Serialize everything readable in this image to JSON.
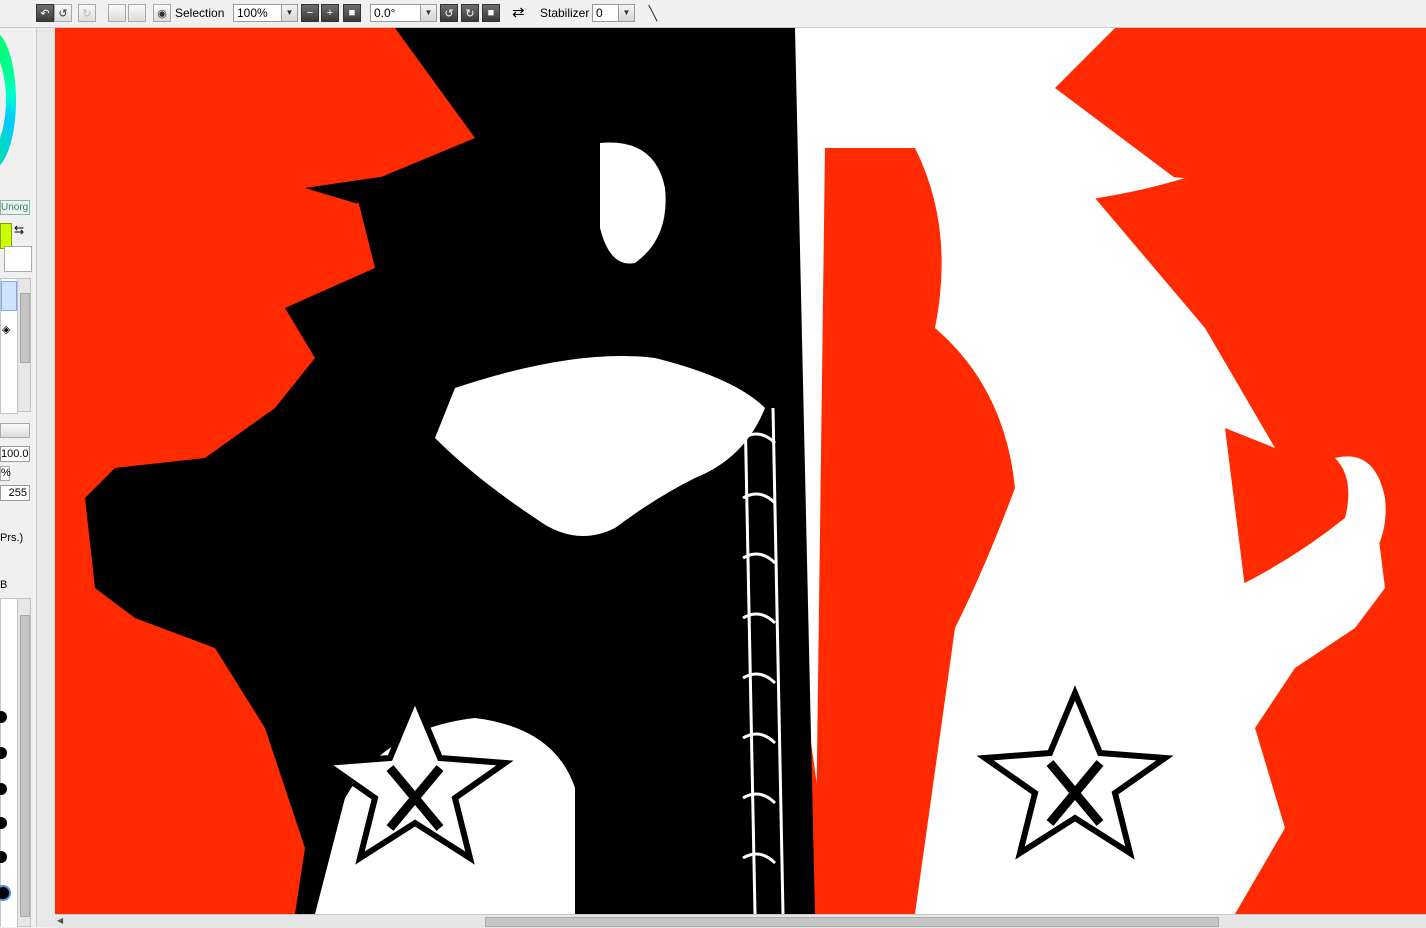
{
  "toolbar": {
    "selection_label": "Selection",
    "zoom_value": "100%",
    "rotation_value": "0.0°",
    "stabilizer_label": "Stabilizer",
    "stabilizer_value": "0"
  },
  "left_panel": {
    "mode_label": "Unorg",
    "opacity_value": "100.0",
    "percent_sign": "%",
    "density_value": "255",
    "pressure_label": "Prs.)",
    "mode_b_label": "B"
  },
  "colors": {
    "foreground": "#ccff00",
    "background": "#ffffff",
    "canvas_bg": "#ff2a00",
    "teal_label": "#2a8a6a"
  },
  "icons": {
    "undo": "undo-icon",
    "redo": "redo-icon",
    "view": "eye-icon",
    "zoom_out": "minus-icon",
    "zoom_in": "plus-icon",
    "zoom_reset": "square-icon",
    "rotate_left": "rotate-ccw-icon",
    "rotate_right": "rotate-cw-icon",
    "rotate_reset": "square-icon",
    "flip": "flip-arrows-icon",
    "brush": "line-brush-icon",
    "swap_colors": "swap-arrows-icon"
  }
}
